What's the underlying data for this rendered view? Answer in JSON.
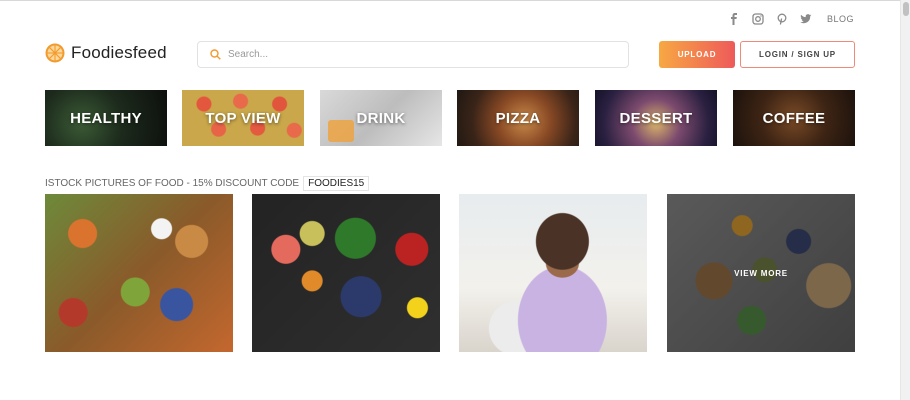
{
  "topbar": {
    "icons": [
      "facebook-icon",
      "instagram-icon",
      "pinterest-icon",
      "twitter-icon"
    ],
    "blog_label": "BLOG"
  },
  "header": {
    "logo_text": "Foodiesfeed",
    "search_placeholder": "Search...",
    "upload_label": "UPLOAD",
    "login_label": "LOGIN / SIGN UP"
  },
  "categories": [
    {
      "label": "HEALTHY"
    },
    {
      "label": "TOP VIEW"
    },
    {
      "label": "DRINK"
    },
    {
      "label": "PIZZA"
    },
    {
      "label": "DESSERT"
    },
    {
      "label": "COFFEE"
    }
  ],
  "promo": {
    "text": "ISTOCK PICTURES OF FOOD - 15% DISCOUNT CODE",
    "code": "FOODIES15"
  },
  "photos": {
    "view_more_label": "VIEW MORE"
  },
  "colors": {
    "accent_start": "#f7a843",
    "accent_end": "#ee5a5a"
  }
}
